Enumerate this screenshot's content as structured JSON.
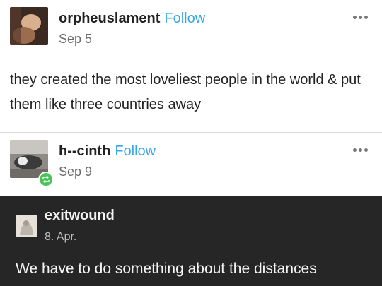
{
  "posts": [
    {
      "username": "orpheuslament",
      "follow_label": "Follow",
      "date": "Sep 5",
      "text": "they created the most loveliest people in the world & put them like three countries away"
    },
    {
      "username": "h--cinth",
      "follow_label": "Follow",
      "date": "Sep 9"
    }
  ],
  "quoted": {
    "username": "exitwound",
    "date": "8. Apr.",
    "text": "We have to do something about the distances"
  },
  "icons": {
    "more": "more-options-icon",
    "reblog": "reblog-icon"
  },
  "colors": {
    "follow": "#3aa7e8",
    "reblog_badge": "#4cc35a",
    "dark_panel": "#262626"
  }
}
